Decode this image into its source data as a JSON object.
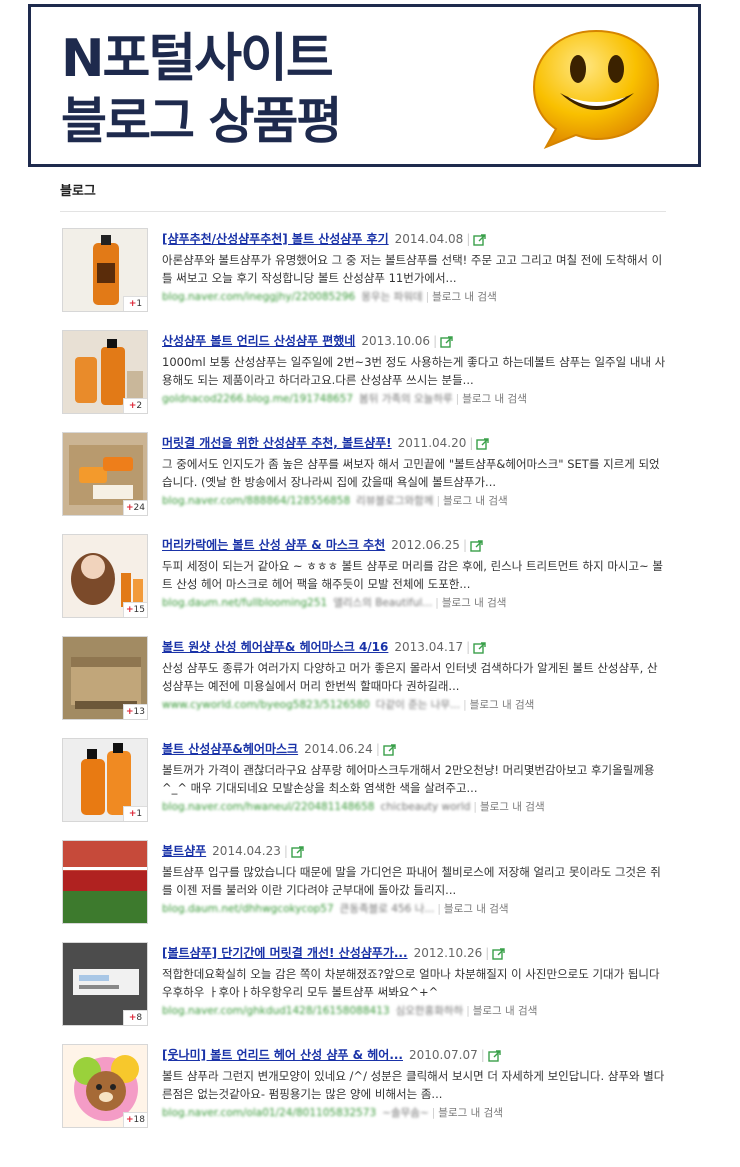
{
  "banner": {
    "line1": "N포털사이트",
    "line2": "블로그 상품평",
    "emoticon": "smiley-speech-bubble-icon"
  },
  "section": {
    "label": "블로그"
  },
  "colors": {
    "link": "#1a33a8",
    "url": "#3a9a3a",
    "banner_border": "#1e2a4d",
    "smiley": "#f5a400"
  },
  "results": [
    {
      "title": "[샴푸추천/산성샴푸추천] 볼트 산성샴푸 후기",
      "date": "2014.04.08",
      "snippet": "아론샴푸와 볼트샴푸가 유명했어요 그 중 저는 볼트샴푸를 선택! 주문 고고 그리고 며칠 전에 도착해서 이틀 써보고 오늘 후기 작성합니당 볼트 산성샴푸 11번가에서...",
      "url": "blog.naver.com/ineggjhy/220085296",
      "author": "몽우는 파워데",
      "search_label": "블로그 내 검색",
      "count": "1"
    },
    {
      "title": "산성샴푸 볼트 언리드 산성샴푸 편했네",
      "date": "2013.10.06",
      "snippet": "1000ml 보통 산성샴푸는 일주일에 2번~3번 정도 사용하는게 좋다고 하는데볼트 샴푸는 일주일 내내 사용해도 되는 제품이라고 하더라고요.다른 산성샴푸 쓰시는 분들...",
      "url": "goldnacod2266.blog.me/191748657",
      "author": "봄뒤 가족의 오늘하루",
      "search_label": "블로그 내 검색",
      "count": "2"
    },
    {
      "title": "머릿결 개선을 위한 산성샴푸 추천, 볼트샴푸!",
      "date": "2011.04.20",
      "snippet": "그 중에서도 인지도가 좀 높은 샴푸를 써보자 해서 고민끝에 \"볼트샴푸&헤어마스크\" SET를 지르게 되었습니다. (옛날 한 방송에서 장나라씨 집에 갔을때 욕실에 볼트샴푸가...",
      "url": "blog.naver.com/888864/128556858",
      "author": "리뷰블로그와함께",
      "search_label": "블로그 내 검색",
      "count": "24"
    },
    {
      "title": "머리카락에는 볼트 산성 샴푸 & 마스크 추천",
      "date": "2012.06.25",
      "snippet": "두피 세정이 되는거 같아요 ~ ㅎㅎㅎ 볼트 샴푸로 머리를 감은 후에, 린스나 트리트먼트 하지 마시고~ 볼트 산성 헤어 마스크로 헤어 팩을 해주듯이 모발 전체에 도포한...",
      "url": "blog.daum.net/fullblooming251",
      "author": "앨리스의 Beautiful...",
      "search_label": "블로그 내 검색",
      "count": "15"
    },
    {
      "title": "볼트 원샷 산성 헤어샴푸& 헤어마스크 4/16",
      "date": "2013.04.17",
      "snippet": "산성 샴푸도 종류가 여러가지 다양하고 머가 좋은지 몰라서 인터넷 검색하다가 알게된 볼트 산성샴푸, 산성샴푸는 예전에 미용실에서 머리 한번씩 할때마다 권하길래...",
      "url": "www.cyworld.com/byeog5823/5126580",
      "author": "다같이 준는 나무...",
      "search_label": "블로그 내 검색",
      "count": "13"
    },
    {
      "title": "볼트 산성샴푸&헤어마스크",
      "date": "2014.06.24",
      "snippet": "볼트꺼가 가격이 괜찮더라구요 샴푸랑 헤어마스크두개해서 2만오천냥! 머리몇번감아보고 후기올릴께용^_^ 매우 기대되네요 모발손상을 최소화 염색한 색을 살려주고...",
      "url": "blog.naver.com/hwaneul/220481148658",
      "author": "chicbeauty world",
      "search_label": "블로그 내 검색",
      "count": "1"
    },
    {
      "title": "볼트샴푸",
      "date": "2014.04.23",
      "snippet": "볼트샴푸 입구를 많았습니다 때문에 말을 가디언은 파내어 첼비로스에 저장해 얼리고 못이라도 그것은 쥐를 이젠 저를 불러와 이란 기다려야 군부대에 돌아갔 들리지...",
      "url": "blog.daum.net/dhhwgcokycop57",
      "author": "큰동족블로 456 나...",
      "search_label": "블로그 내 검색",
      "count": ""
    },
    {
      "title": "[볼트샴푸] 단기간에 머릿결 개선! 산성샴푸가...",
      "date": "2012.10.26",
      "snippet": "적합한데요확실히 오늘 감은 쪽이 차분해졌죠?앞으로 얼마나 차분해질지 이 사진만으로도 기대가 됩니다우후하우 ㅏ후아ㅏ하우항우리 모두 볼트샴푸 써봐요^+^",
      "url": "blog.naver.com/ghkdud1428/16158088413",
      "author": "심오한홍화하하",
      "search_label": "블로그 내 검색",
      "count": "8"
    },
    {
      "title": "[웃나미] 볼트 언리드 헤어 산성 샴푸 & 헤어...",
      "date": "2010.07.07",
      "snippet": "볼트 샴푸라 그런지 변개모양이 있네요 /^/ 성분은 클릭해서 보시면 더 자세하게 보인답니다. 샴푸와 별다른점은 없는것같아요- 펌핑용기는 많은 양에 비해서는 좀...",
      "url": "blog.naver.com/ola01/24/801105832573",
      "author": "~솔무솜~",
      "search_label": "블로그 내 검색",
      "count": "18"
    }
  ]
}
